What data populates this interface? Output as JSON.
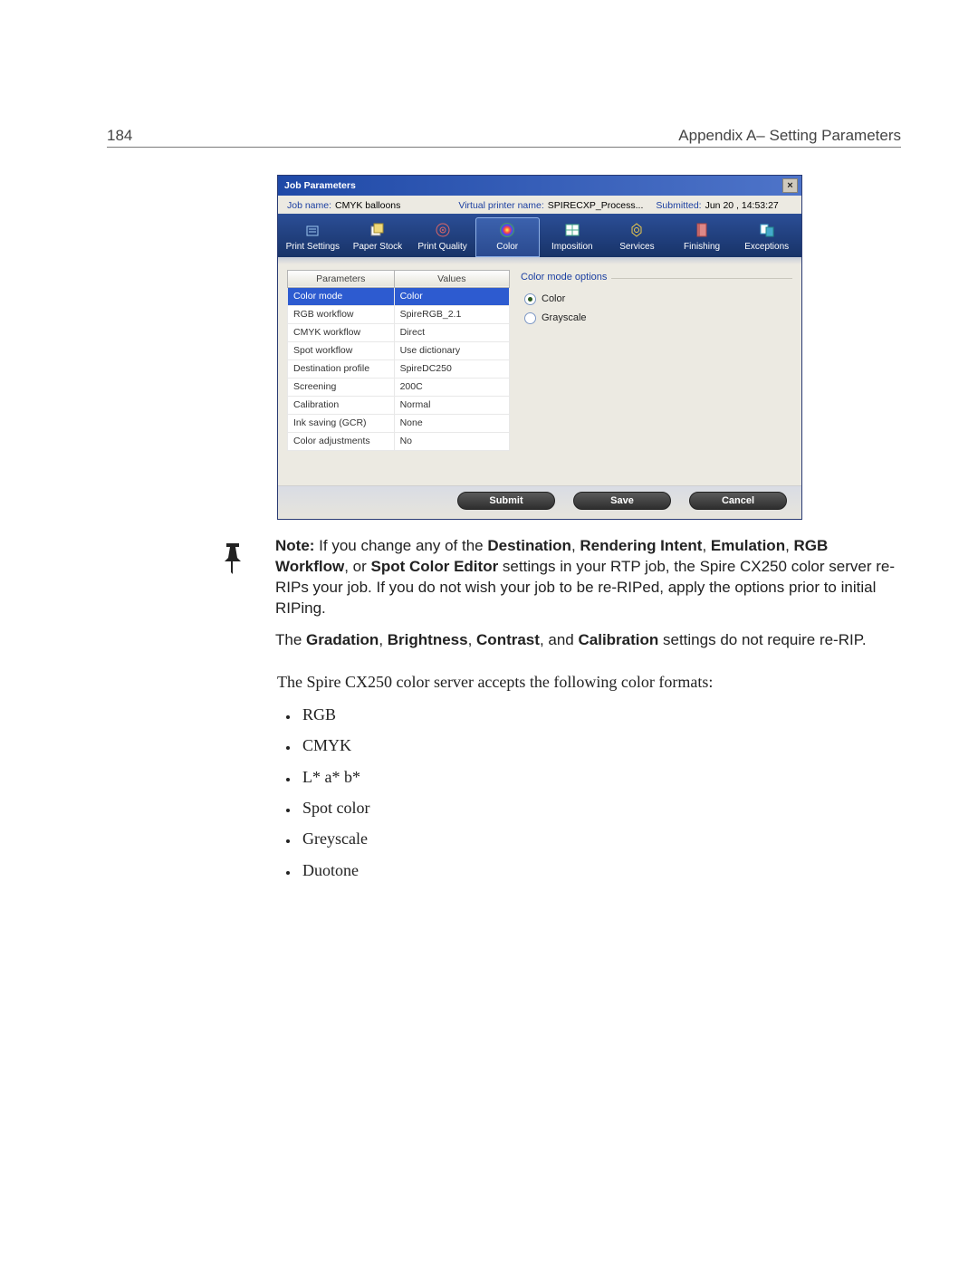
{
  "page_number": "184",
  "header_text": "Appendix A– Setting Parameters",
  "dialog": {
    "title": "Job Parameters",
    "job_name_label": "Job name:",
    "job_name_value": "CMYK balloons",
    "vp_label": "Virtual printer name:",
    "vp_value": "SPIRECXP_Process...",
    "submitted_label": "Submitted:",
    "submitted_value": "Jun 20 , 14:53:27",
    "tabs": [
      {
        "label": "Print Settings"
      },
      {
        "label": "Paper Stock"
      },
      {
        "label": "Print Quality"
      },
      {
        "label": "Color"
      },
      {
        "label": "Imposition"
      },
      {
        "label": "Services"
      },
      {
        "label": "Finishing"
      },
      {
        "label": "Exceptions"
      }
    ],
    "table_headers": {
      "param": "Parameters",
      "val": "Values"
    },
    "params": [
      {
        "name": "Color mode",
        "value": "Color"
      },
      {
        "name": "RGB workflow",
        "value": "SpireRGB_2.1"
      },
      {
        "name": "CMYK workflow",
        "value": "Direct"
      },
      {
        "name": "Spot workflow",
        "value": "Use dictionary"
      },
      {
        "name": "Destination profile",
        "value": "SpireDC250"
      },
      {
        "name": "Screening",
        "value": "200C"
      },
      {
        "name": "Calibration",
        "value": "Normal"
      },
      {
        "name": "Ink saving (GCR)",
        "value": "None"
      },
      {
        "name": "Color adjustments",
        "value": "No"
      }
    ],
    "options_title": "Color mode options",
    "options": [
      {
        "label": "Color",
        "selected": true
      },
      {
        "label": "Grayscale",
        "selected": false
      }
    ],
    "buttons": {
      "submit": "Submit",
      "save": "Save",
      "cancel": "Cancel"
    }
  },
  "note": {
    "lead": "Note:",
    "p1a": "  If you change any of the ",
    "b1": "Destination",
    "sep": ", ",
    "b2": "Rendering Intent",
    "b3": "Emulation",
    "b4": "RGB Workflow",
    "or": ", or ",
    "b5": "Spot Color Editor",
    "p1b": " settings in your RTP job, the Spire CX250 color server re-RIPs your job. If you do not wish your job to be re-RIPed, apply the options prior to initial RIPing.",
    "p2a": "The ",
    "b6": "Gradation",
    "b7": "Brightness",
    "b8": "Contrast",
    "and": ", and ",
    "b9": "Calibration",
    "p2b": " settings do not require re-RIP."
  },
  "body_intro": "The Spire CX250 color server accepts the following color formats:",
  "formats": [
    "RGB",
    "CMYK",
    "L* a* b*",
    "Spot color",
    "Greyscale",
    "Duotone"
  ]
}
